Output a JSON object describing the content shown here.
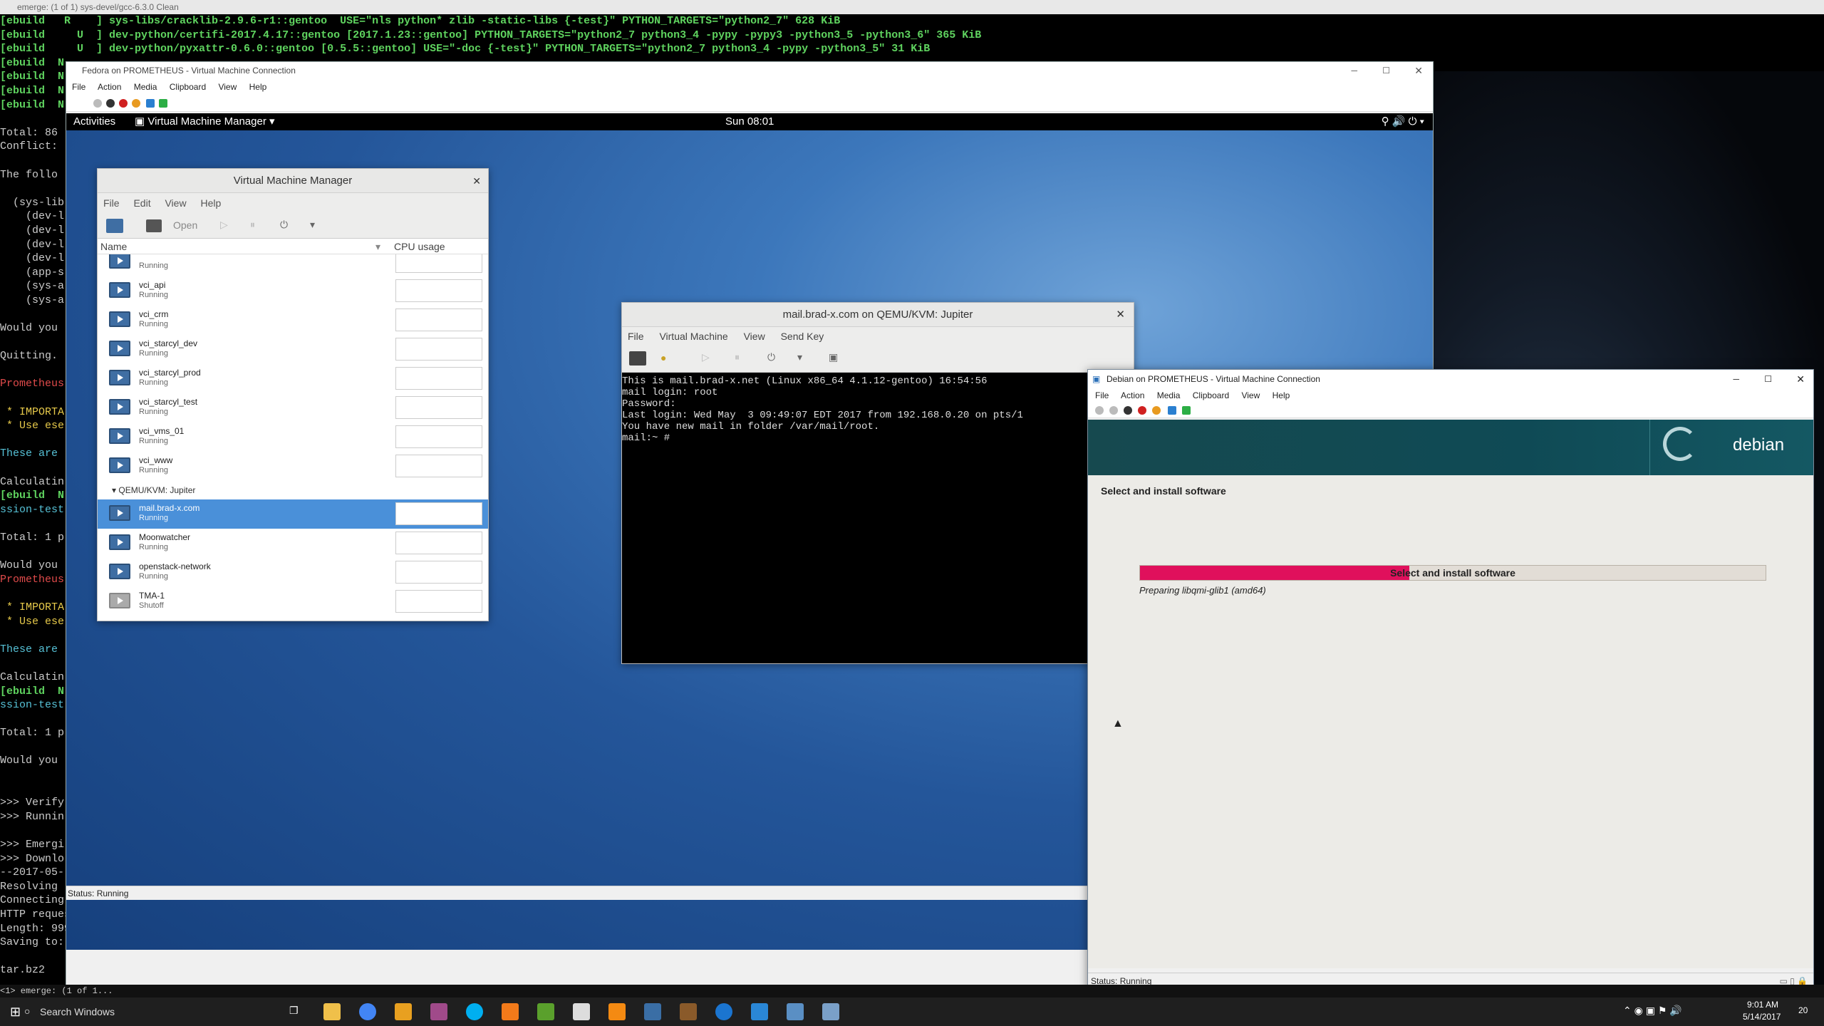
{
  "terminal": {
    "window_title": "emerge: (1 of 1) sys-devel/gcc-6.3.0 Clean",
    "lines": [
      "[ebuild   R    ] sys-libs/cracklib-2.9.6-r1::gentoo  USE=\"nls python* zlib -static-libs {-test}\" PYTHON_TARGETS=\"python2_7\" 628 KiB",
      "[ebuild     U  ] dev-python/certifi-2017.4.17::gentoo [2017.1.23::gentoo] PYTHON_TARGETS=\"python2_7 python3_4 -pypy -pypy3 -python3_5 -python3_6\" 365 KiB",
      "[ebuild     U  ] dev-python/pyxattr-0.6.0::gentoo [0.5.5::gentoo] USE=\"-doc {-test}\" PYTHON_TARGETS=\"python2_7 python3_4 -pypy -python3_5\" 31 KiB",
      "[ebuild  N",
      "[ebuild  N",
      "[ebuild  N",
      "[ebuild  N",
      "",
      "Total: 86",
      "Conflict:",
      "",
      "The follo",
      "",
      "  (sys-lib",
      "    (dev-l",
      "    (dev-l",
      "    (dev-l",
      "    (dev-l",
      "    (app-s",
      "    (sys-a",
      "    (sys-a",
      "",
      "Would you",
      "",
      "Quitting.",
      "",
      "Prometheus",
      "",
      " * IMPORTA",
      " * Use ese",
      "",
      "These are",
      "",
      "Calculatin",
      "[ebuild  N",
      "ssion-test",
      "",
      "Total: 1 p",
      "",
      "Would you",
      "Prometheus",
      "",
      " * IMPORTA",
      " * Use ese",
      "",
      "These are",
      "",
      "Calculatin",
      "[ebuild  N",
      "ssion-test",
      "",
      "Total: 1 p",
      "",
      "Would you",
      "",
      "",
      ">>> Verify",
      ">>> Runnin",
      "",
      ">>> Emergi",
      ">>> Downlo",
      "--2017-05-",
      "Resolving",
      "Connecting to distfiles.gentoo.org|64.50.233.100|:80... connected.",
      "HTTP request sent, awaiting response... 200 OK",
      "Length: 99903185 (95M) [application/x-bzip2]",
      "Saving to: '/usr/portage/distfiles/gcc-6.3.0.tar.bz2'",
      "",
      "tar.bz2                  78%[==============>      ]  74.79M  1.53MB/s    eta 9s"
    ],
    "tmux_status": "<1> emerge: (1 of 1..."
  },
  "fedora_window": {
    "title": "Fedora on PROMETHEUS - Virtual Machine Connection",
    "menu": [
      "File",
      "Action",
      "Media",
      "Clipboard",
      "View",
      "Help"
    ],
    "status": "Status: Running"
  },
  "gnome": {
    "activities": "Activities",
    "app_menu": "Virtual Machine Manager",
    "clock": "Sun 08:01"
  },
  "vmm": {
    "title": "Virtual Machine Manager",
    "menu": [
      "File",
      "Edit",
      "View",
      "Help"
    ],
    "open_label": "Open",
    "col_name": "Name",
    "col_cpu": "CPU usage",
    "vms_top": [
      {
        "name": "",
        "state": "Running"
      },
      {
        "name": "vci_api",
        "state": "Running"
      },
      {
        "name": "vci_crm",
        "state": "Running"
      },
      {
        "name": "vci_starcyl_dev",
        "state": "Running"
      },
      {
        "name": "vci_starcyl_prod",
        "state": "Running"
      },
      {
        "name": "vci_starcyl_test",
        "state": "Running"
      },
      {
        "name": "vci_vms_01",
        "state": "Running"
      },
      {
        "name": "vci_www",
        "state": "Running"
      }
    ],
    "group_label": "QEMU/KVM: Jupiter",
    "vms_jupiter": [
      {
        "name": "mail.brad-x.com",
        "state": "Running"
      },
      {
        "name": "Moonwatcher",
        "state": "Running"
      },
      {
        "name": "openstack-network",
        "state": "Running"
      },
      {
        "name": "TMA-1",
        "state": "Shutoff"
      }
    ]
  },
  "jupiter_viewer": {
    "title": "mail.brad-x.com on QEMU/KVM: Jupiter",
    "menu": [
      "File",
      "Virtual Machine",
      "View",
      "Send Key"
    ],
    "console": [
      "",
      "This is mail.brad-x.net (Linux x86_64 4.1.12-gentoo) 16:54:56",
      "",
      "mail login: root",
      "Password:",
      "Last login: Wed May  3 09:49:07 EDT 2017 from 192.168.0.20 on pts/1",
      "You have new mail in folder /var/mail/root.",
      "mail:~ #"
    ]
  },
  "debian_window": {
    "title": "Debian on PROMETHEUS - Virtual Machine Connection",
    "menu": [
      "File",
      "Action",
      "Media",
      "Clipboard",
      "View",
      "Help"
    ],
    "brand": "debian",
    "heading": "Select and install software",
    "progress_label": "Select and install software",
    "progress_fraction": 0.43,
    "progress_detail": "Preparing libqmi-glib1 (amd64)",
    "status": "Status: Running"
  },
  "taskbar": {
    "search_placeholder": "Search Windows",
    "time": "9:01 AM",
    "date": "5/14/2017",
    "notification_count": "20"
  },
  "colors": {
    "progress_fill": "#e0105c",
    "selection": "#4a90d9",
    "debian_banner": "#0f4a55"
  }
}
